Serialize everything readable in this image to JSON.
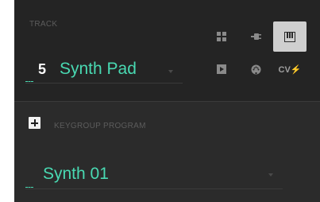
{
  "track": {
    "section_label": "TRACK",
    "number": "5",
    "name": "Synth Pad"
  },
  "program": {
    "section_label": "KEYGROUP PROGRAM",
    "name": "Synth 01"
  },
  "track_types": [
    {
      "icon": "grid-icon",
      "state": "inactive"
    },
    {
      "icon": "plug-icon",
      "state": "inactive"
    },
    {
      "icon": "piano-keys-icon",
      "state": "active"
    },
    {
      "icon": "clip-icon",
      "state": "inactive"
    },
    {
      "icon": "midi-icon",
      "state": "inactive"
    },
    {
      "icon": "cv-icon",
      "label": "CV⚡",
      "state": "inactive"
    }
  ],
  "colors": {
    "accent": "#49d9b2",
    "background": "#2b2b2b",
    "track_background": "#242424",
    "active_button": "#cfcfcf"
  }
}
